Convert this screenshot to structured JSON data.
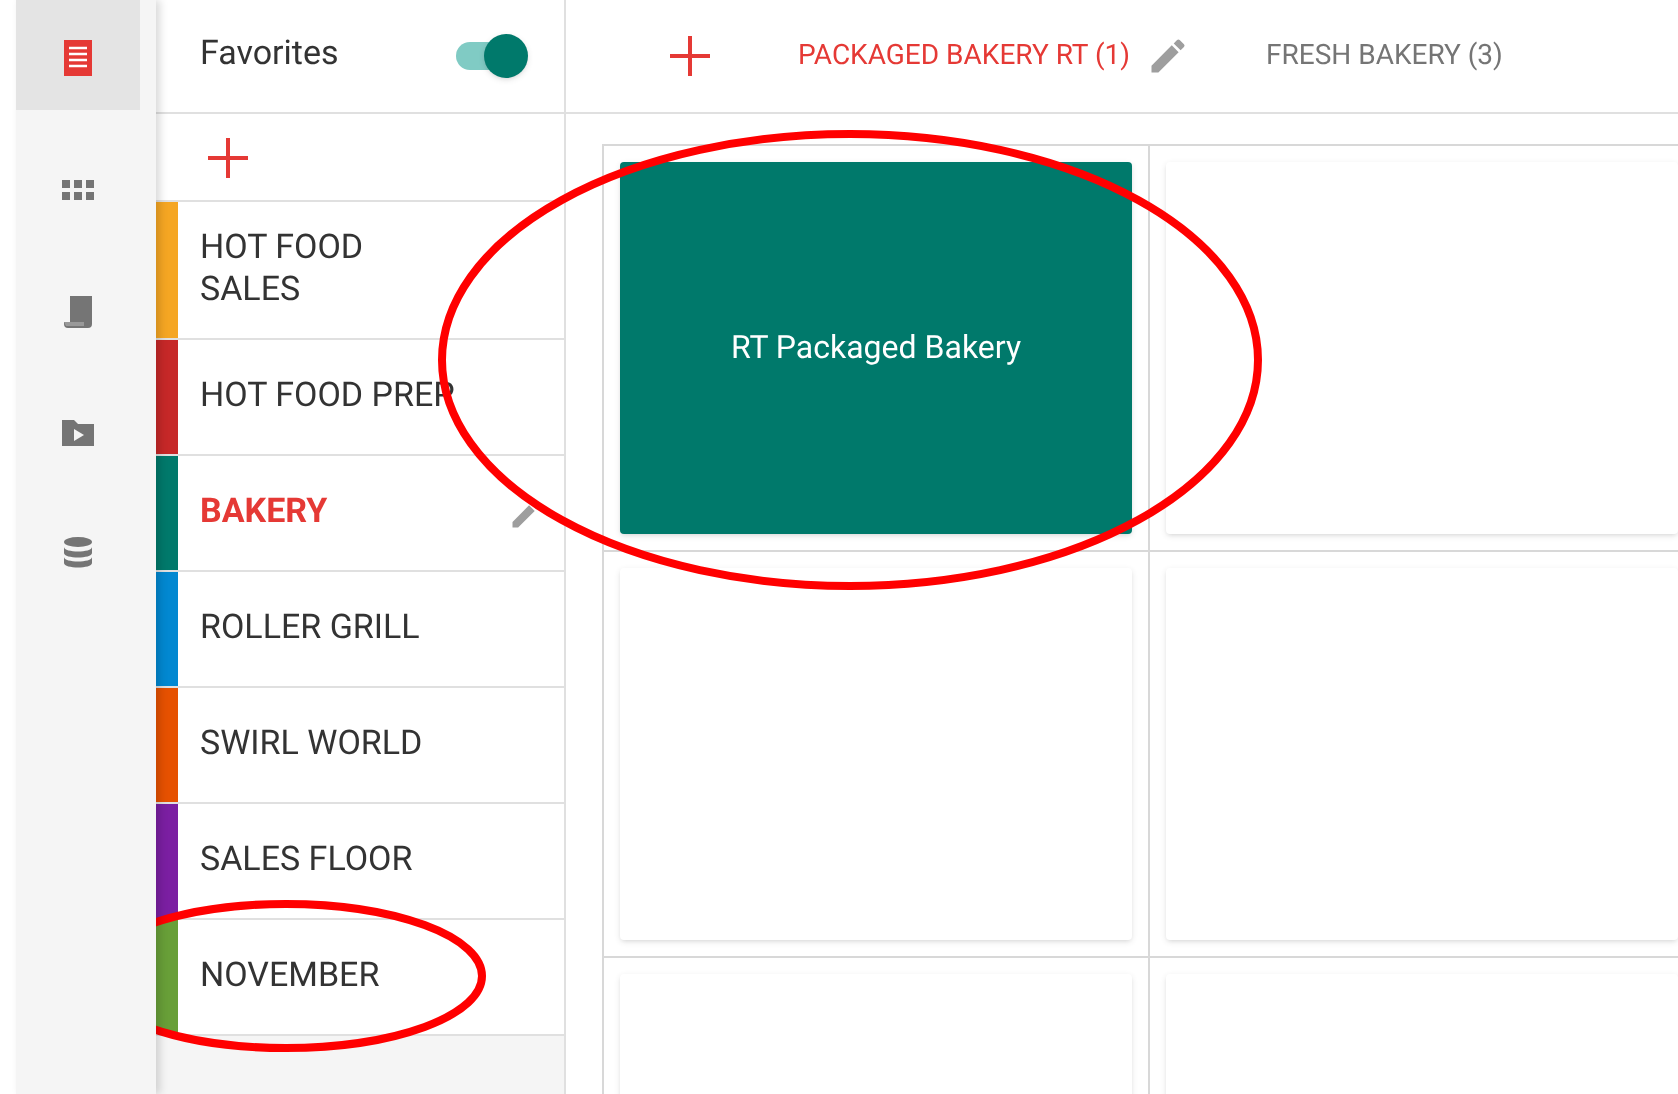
{
  "rail": [
    {
      "kind": "list",
      "selected": true
    },
    {
      "kind": "grid",
      "selected": false
    },
    {
      "kind": "receipt",
      "selected": false
    },
    {
      "kind": "video-folder",
      "selected": false
    },
    {
      "kind": "database",
      "selected": false
    }
  ],
  "favorites": {
    "label": "Favorites",
    "on": true
  },
  "categories": [
    {
      "label": "HOT FOOD SALES",
      "color": "#f5a623",
      "selected": false
    },
    {
      "label": "HOT FOOD PREP",
      "color": "#c62828",
      "selected": false
    },
    {
      "label": "BAKERY",
      "color": "#00796b",
      "selected": true
    },
    {
      "label": "ROLLER GRILL",
      "color": "#0288d1",
      "selected": false
    },
    {
      "label": "SWIRL WORLD",
      "color": "#e65100",
      "selected": false
    },
    {
      "label": "SALES FLOOR",
      "color": "#7b1fa2",
      "selected": false
    },
    {
      "label": "NOVEMBER",
      "color": "#689f38",
      "selected": false
    }
  ],
  "tabs": [
    {
      "label": "PACKAGED BAKERY RT (1)",
      "selected": true
    },
    {
      "label": "FRESH BAKERY (3)",
      "selected": false
    }
  ],
  "tiles": [
    {
      "kind": "item",
      "label": "RT Packaged Bakery",
      "color": "#00796b"
    },
    {
      "kind": "empty"
    },
    {
      "kind": "empty"
    },
    {
      "kind": "empty"
    },
    {
      "kind": "empty"
    },
    {
      "kind": "empty"
    }
  ]
}
